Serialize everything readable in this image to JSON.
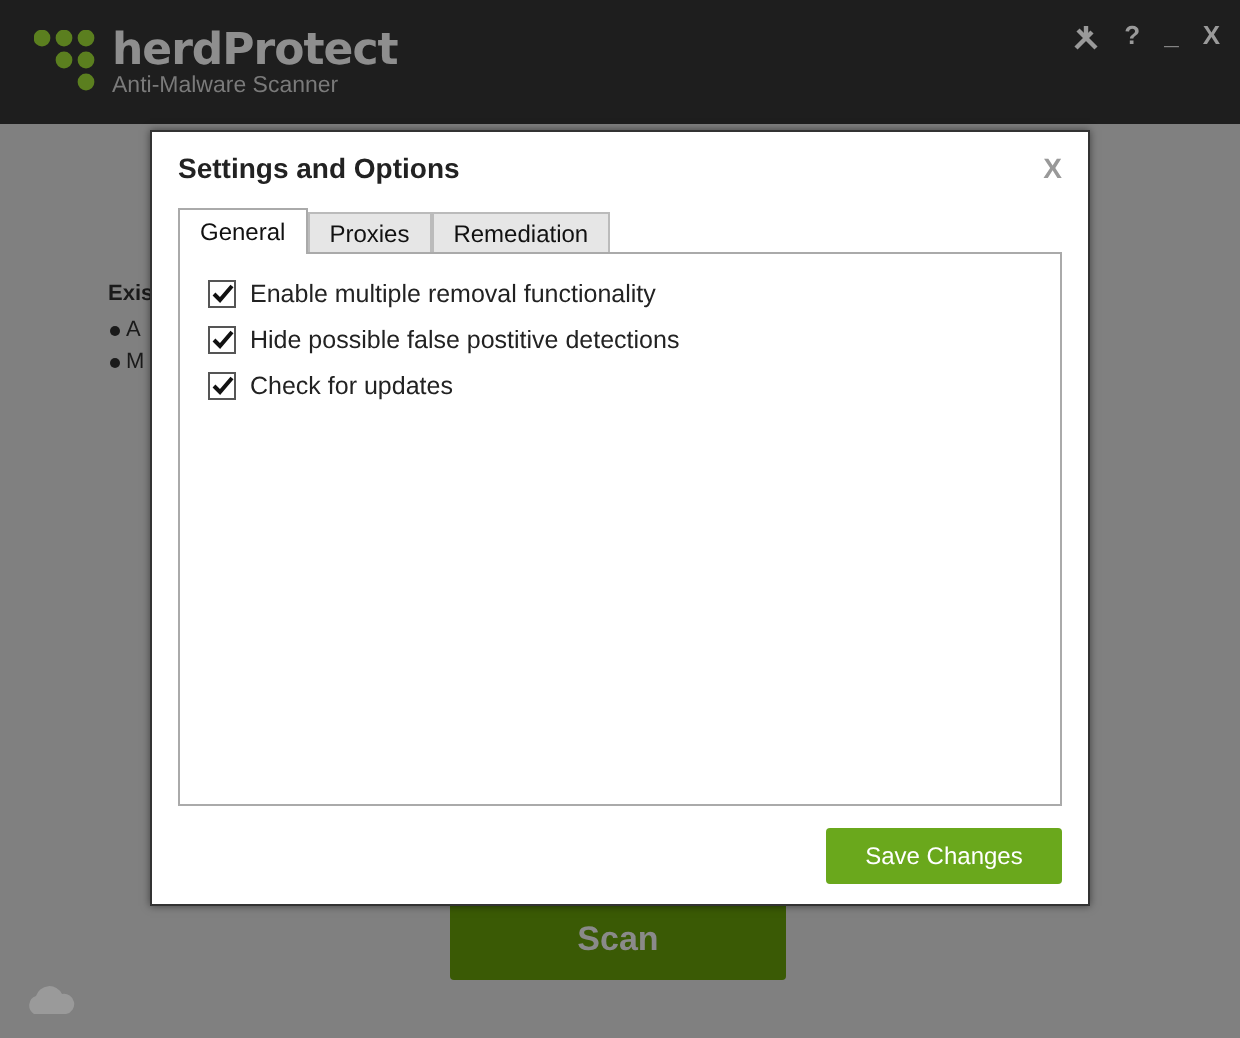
{
  "app": {
    "title": "herdProtect",
    "subtitle": "Anti-Malware Scanner",
    "controls": [
      "?",
      "_",
      "X"
    ]
  },
  "background": {
    "heading": "Exis",
    "bullets": [
      "A",
      "M"
    ],
    "scan_button": "Scan"
  },
  "dialog": {
    "title": "Settings and Options",
    "close": "X",
    "tabs": [
      {
        "label": "General",
        "selected": true
      },
      {
        "label": "Proxies",
        "selected": false
      },
      {
        "label": "Remediation",
        "selected": false
      }
    ],
    "options": [
      {
        "label": "Enable multiple removal functionality",
        "checked": true
      },
      {
        "label": "Hide possible false postitive detections",
        "checked": true
      },
      {
        "label": "Check for updates",
        "checked": true
      }
    ],
    "save_button": "Save Changes"
  }
}
